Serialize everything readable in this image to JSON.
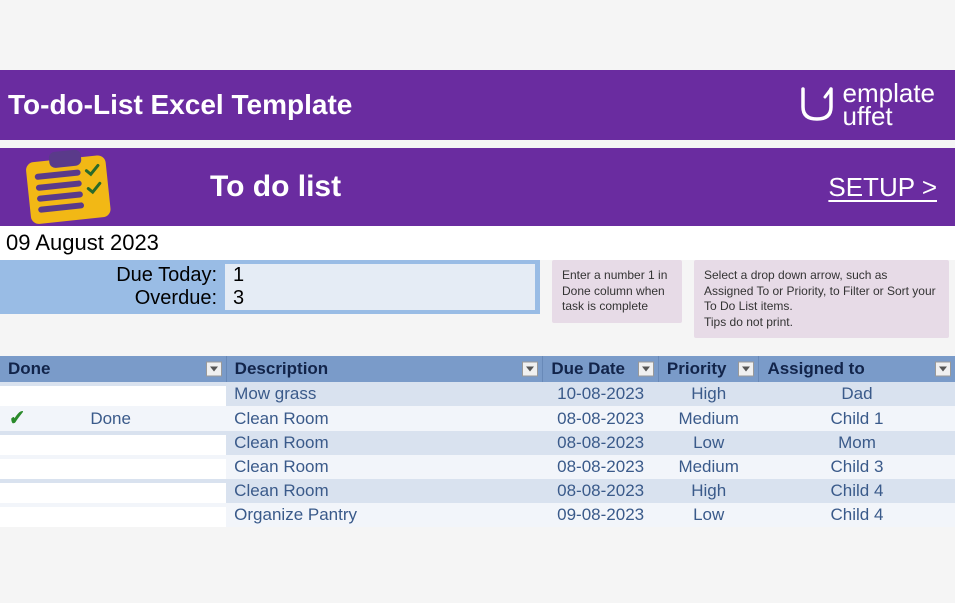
{
  "header": {
    "title": "To-do-List Excel Template",
    "logo_top": "emplate",
    "logo_bottom": "uffet"
  },
  "subheader": {
    "title": "To do list",
    "setup": "SETUP >"
  },
  "date": "09 August 2023",
  "summary": {
    "due_today_label": "Due Today:",
    "due_today_value": "1",
    "overdue_label": "Overdue:",
    "overdue_value": "3"
  },
  "tips": {
    "tip1": "Enter a number 1 in Done column when task is complete",
    "tip2": "Select a drop down arrow, such as Assigned To or Priority, to Filter or Sort your To Do List items.\nTips do not print."
  },
  "columns": {
    "done": "Done",
    "description": "Description",
    "due_date": "Due Date",
    "priority": "Priority",
    "assigned": "Assigned to"
  },
  "rows": [
    {
      "done_icon": "",
      "done_label": "",
      "description": "Mow grass",
      "due_date": "10-08-2023",
      "priority": "High",
      "assigned": "Dad",
      "highlight": false
    },
    {
      "done_icon": "✔",
      "done_label": "Done",
      "description": "Clean Room",
      "due_date": "08-08-2023",
      "priority": "Medium",
      "assigned": "Child 1",
      "highlight": false
    },
    {
      "done_icon": "",
      "done_label": "",
      "description": "Clean Room",
      "due_date": "08-08-2023",
      "priority": "Low",
      "assigned": "Mom",
      "highlight": false
    },
    {
      "done_icon": "",
      "done_label": "",
      "description": "Clean Room",
      "due_date": "08-08-2023",
      "priority": "Medium",
      "assigned": "Child 3",
      "highlight": false
    },
    {
      "done_icon": "",
      "done_label": "",
      "description": "Clean Room",
      "due_date": "08-08-2023",
      "priority": "High",
      "assigned": "Child 4",
      "highlight": false
    },
    {
      "done_icon": "",
      "done_label": "",
      "description": "Organize Pantry",
      "due_date": "09-08-2023",
      "priority": "Low",
      "assigned": "Child 4",
      "highlight": true
    }
  ]
}
